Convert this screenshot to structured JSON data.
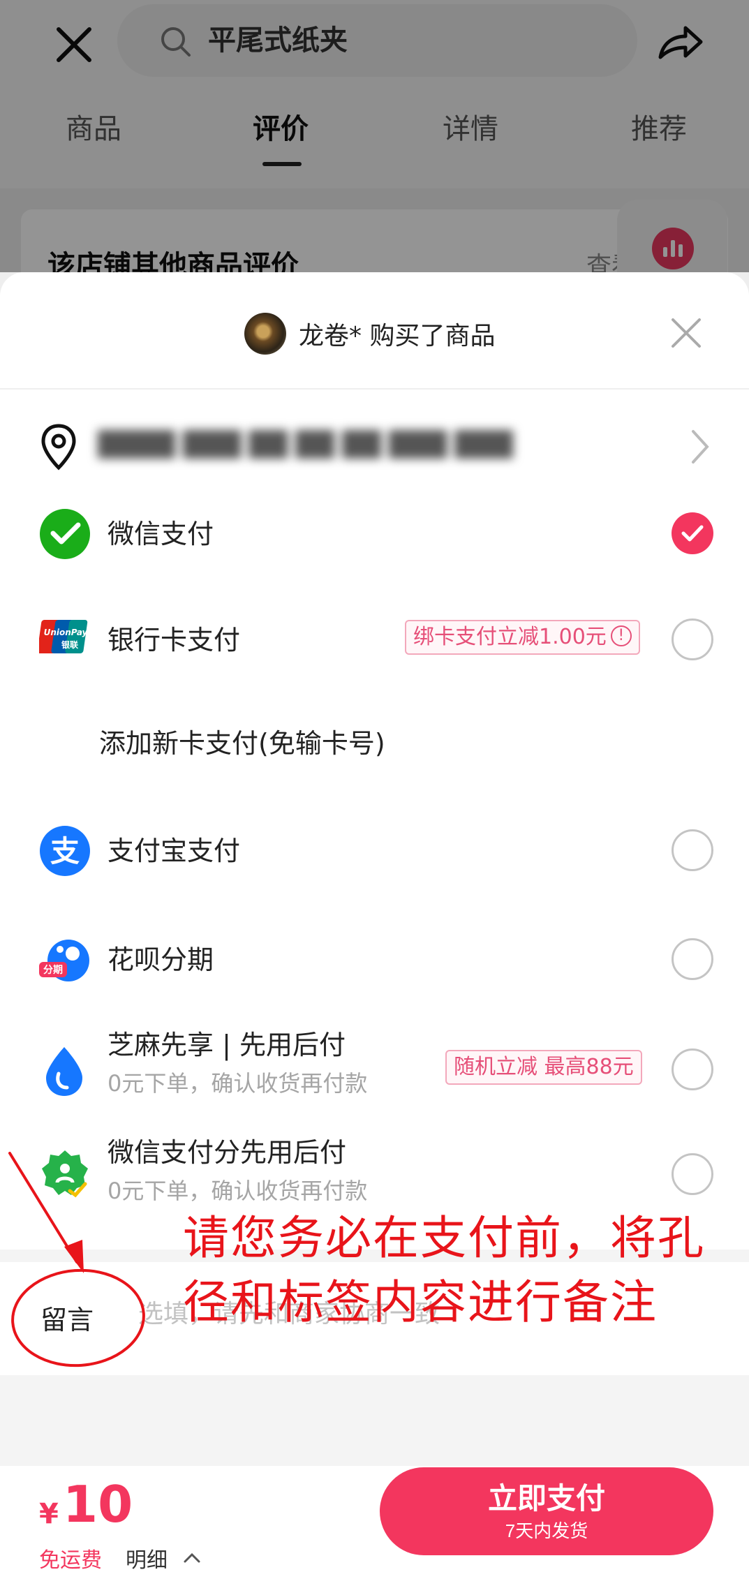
{
  "background": {
    "search_text": "平尾式纸夹",
    "tabs": [
      "商品",
      "评价",
      "详情",
      "推荐"
    ],
    "active_tab": "评价",
    "card_title": "该店铺其他商品评价",
    "card_more": "查看全部"
  },
  "sheet": {
    "buyer_text": "龙卷* 购买了商品",
    "address_masked": "████ ███ ██ ██ ██ ███ ███"
  },
  "payments": [
    {
      "label": "微信支付",
      "selected": true
    },
    {
      "label": "银行卡支付",
      "promo": "绑卡支付立减1.00元",
      "selected": false
    },
    {
      "label": "添加新卡支付(免输卡号)"
    },
    {
      "label": "支付宝支付",
      "selected": false
    },
    {
      "label": "花呗分期",
      "icon_badge": "分期",
      "selected": false
    },
    {
      "label": "芝麻先享 | 先用后付",
      "sub": "0元下单，确认收货再付款",
      "promo": "随机立减 最高88元",
      "selected": false
    },
    {
      "label": "微信支付分先用后付",
      "sub": "0元下单，确认收货再付款",
      "selected": false
    }
  ],
  "unionpay_badge": {
    "top": "UnionPay",
    "bottom": "银联"
  },
  "message": {
    "label": "留言",
    "placeholder": "选填，请先和商家协商一致"
  },
  "bottom_bar": {
    "currency": "¥",
    "price": "10",
    "shipping": "免运费",
    "detail": "明细",
    "pay_button": "立即支付",
    "pay_button_sub": "7天内发货"
  },
  "annotation": {
    "text": "请您务必在支付前，将孔径和标签内容进行备注"
  },
  "colors": {
    "accent": "#f3365e",
    "wechat_green": "#1aad19",
    "alipay_blue": "#1677ff",
    "annotation_red": "#e8141a"
  }
}
